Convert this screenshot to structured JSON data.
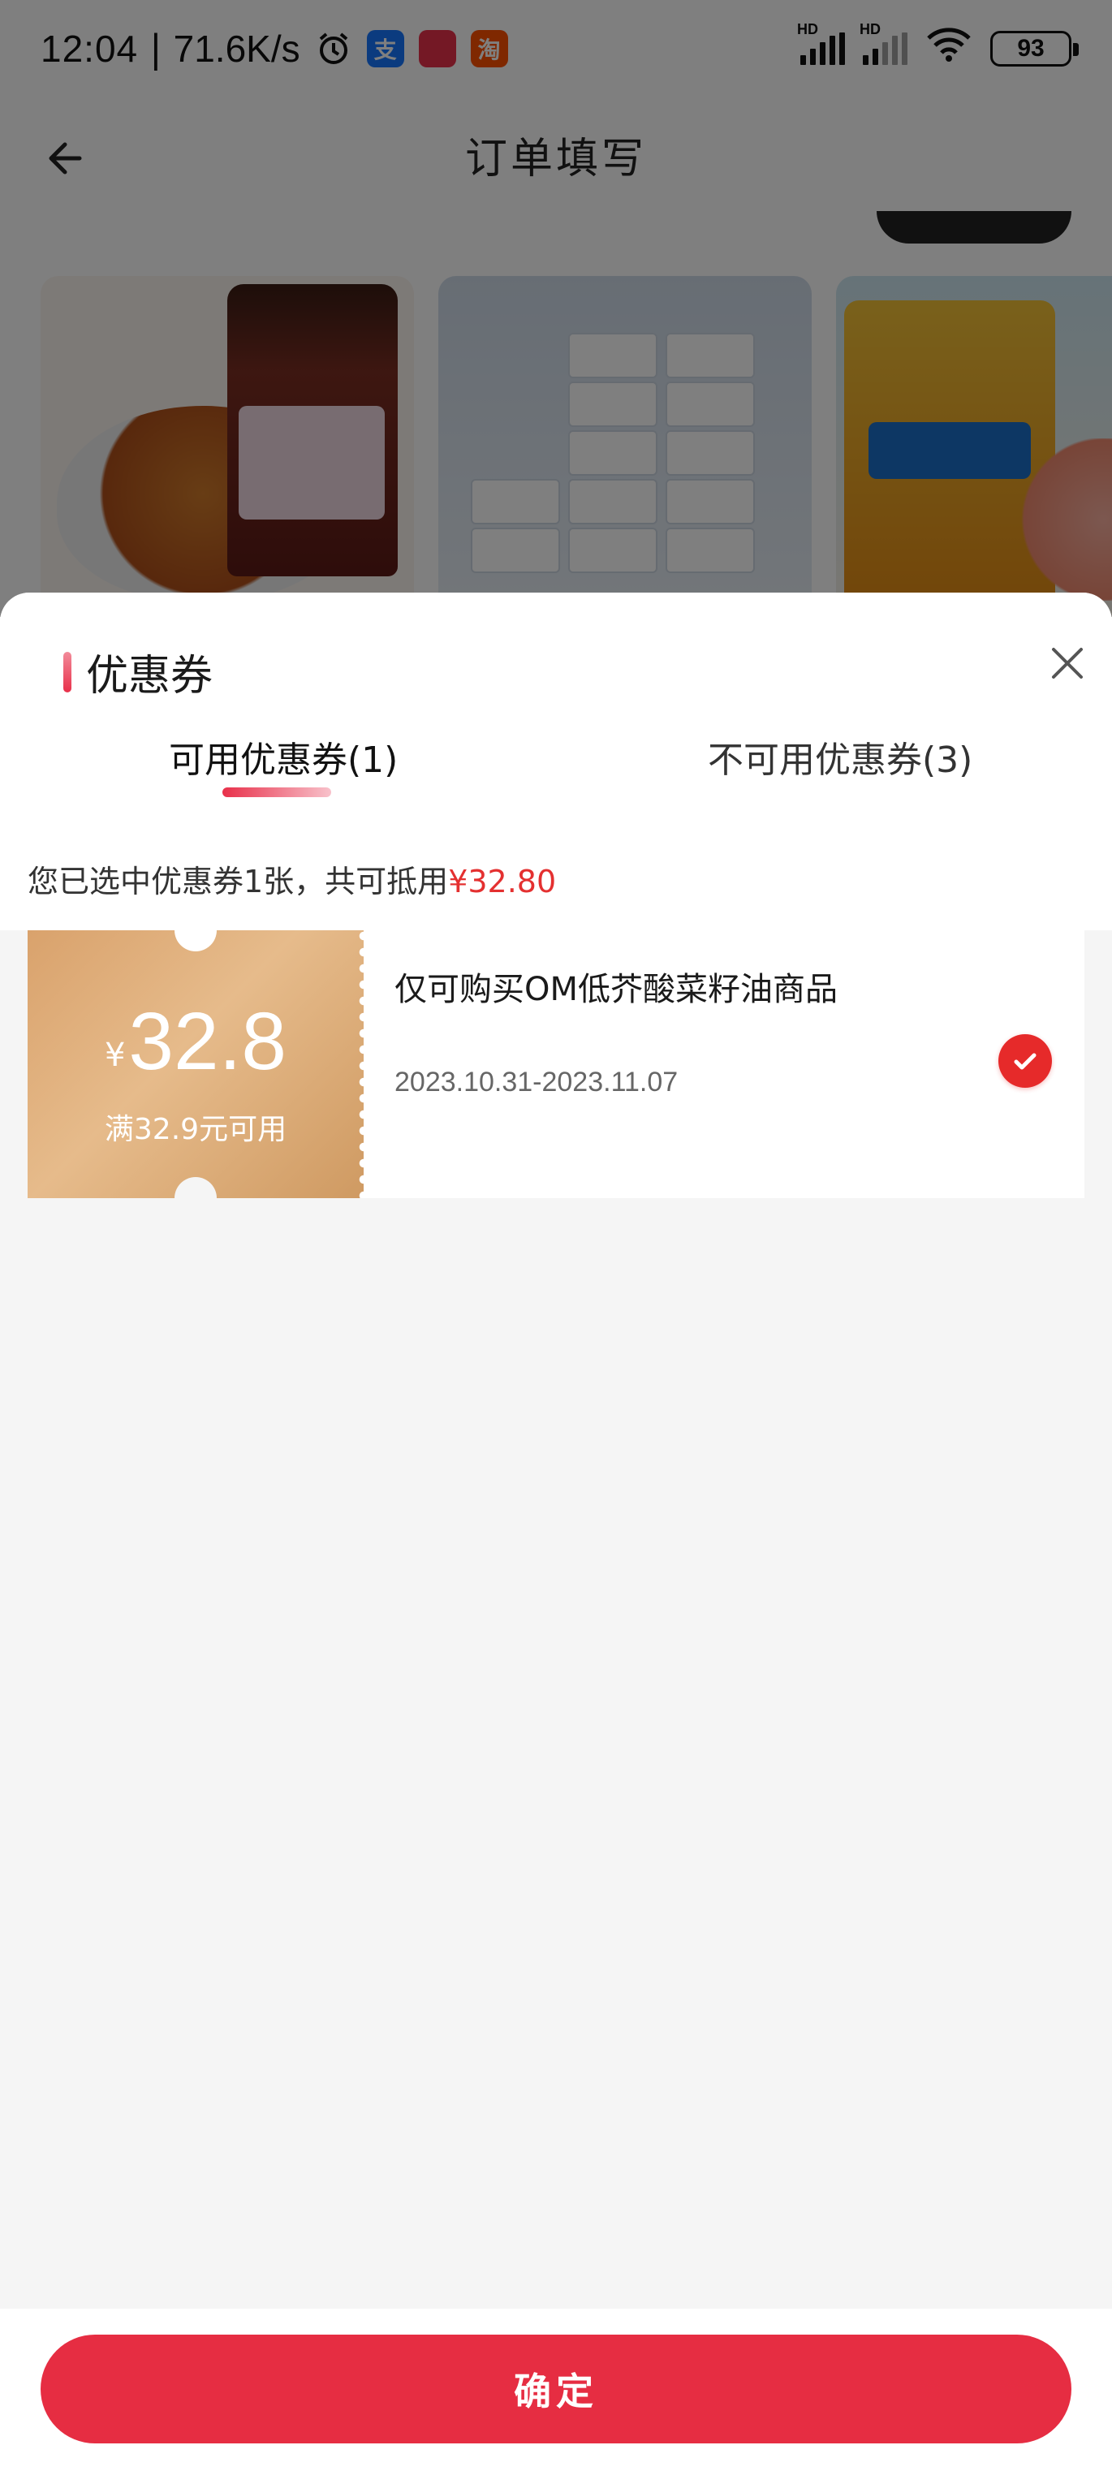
{
  "status_bar": {
    "time": "12:04",
    "separator": "|",
    "net_speed": "71.6K/s",
    "signal_label": "HD",
    "battery": "93"
  },
  "nav": {
    "title": "订单填写"
  },
  "colors": {
    "primary_red": "#e62d42",
    "accent_red": "#e43030",
    "coupon_gold": "#d9a26c"
  },
  "sheet": {
    "title": "优惠券",
    "tabs": [
      {
        "label": "可用优惠券(1)",
        "active": true
      },
      {
        "label": "不可用优惠券(3)",
        "active": false
      }
    ],
    "summary_prefix": "您已选中优惠券1张，共可抵用",
    "summary_amount": "¥32.80",
    "coupons": [
      {
        "currency": "¥",
        "amount": "32.8",
        "condition": "满32.9元可用",
        "description": "仅可购买OM低芥酸菜籽油商品",
        "validity": "2023.10.31-2023.11.07",
        "selected": true
      }
    ]
  },
  "footer": {
    "confirm_label": "确定"
  }
}
